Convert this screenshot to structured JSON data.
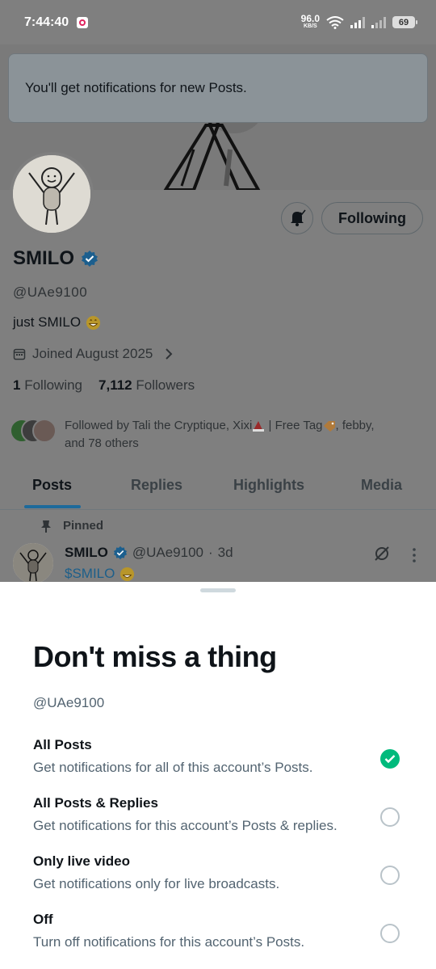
{
  "status_bar": {
    "time": "7:44:40",
    "net_speed_value": "96.0",
    "net_speed_unit": "KB/S",
    "battery": "69"
  },
  "toast": {
    "message": "You'll get notifications for new Posts."
  },
  "profile": {
    "following_button": "Following",
    "name": "SMILO",
    "handle": "@UAe9100",
    "bio": "just SMILO",
    "joined": "Joined August 2025",
    "following_count": "1",
    "following_label": "Following",
    "followers_count": "7,112",
    "followers_label": "Followers",
    "followed_by_prefix": "Followed by Tali the Cryptique, Xixi",
    "followed_by_mid": " | Free Tag",
    "followed_by_suffix": ", febby,",
    "followed_by_line2": "and 78 others"
  },
  "tabs": [
    {
      "label": "Posts",
      "active": true
    },
    {
      "label": "Replies",
      "active": false
    },
    {
      "label": "Highlights",
      "active": false
    },
    {
      "label": "Media",
      "active": false
    }
  ],
  "pinned_post": {
    "pinned_label": "Pinned",
    "author_name": "SMILO",
    "author_handle": "@UAe9100",
    "separator": "·",
    "age": "3d",
    "text": "$SMILO"
  },
  "sheet": {
    "title": "Don't miss a thing",
    "handle": "@UAe9100",
    "options": [
      {
        "title": "All Posts",
        "description": "Get notifications for all of this account’s Posts.",
        "selected": true
      },
      {
        "title": "All Posts & Replies",
        "description": "Get notifications for this account’s Posts & replies.",
        "selected": false
      },
      {
        "title": "Only live video",
        "description": "Get notifications only for live broadcasts.",
        "selected": false
      },
      {
        "title": "Off",
        "description": "Turn off notifications for this account’s Posts.",
        "selected": false
      }
    ]
  },
  "colors": {
    "verified": "#1d9bf0",
    "selected_radio": "#00ba7c",
    "link": "#1d9bf0",
    "dim_overlay": "#7f7f7f"
  }
}
